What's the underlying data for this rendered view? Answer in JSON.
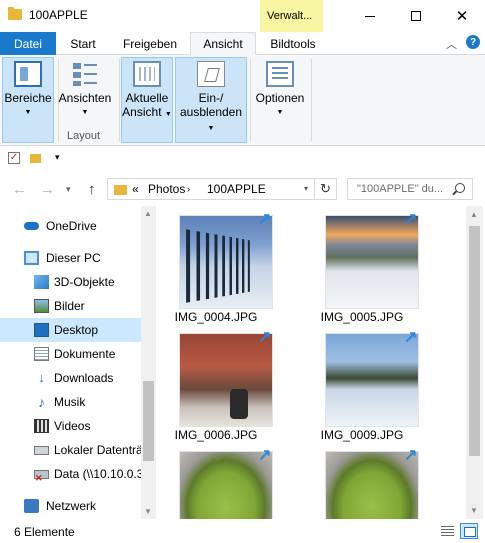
{
  "window": {
    "title": "100APPLE",
    "context_tab_header": "Verwalt...",
    "minimize_icon": "minimize-icon",
    "maximize_icon": "maximize-icon",
    "close_icon": "close-icon"
  },
  "tabs": [
    {
      "label": "Datei"
    },
    {
      "label": "Start"
    },
    {
      "label": "Freigeben"
    },
    {
      "label": "Ansicht"
    },
    {
      "label": "Bildtools"
    }
  ],
  "ribbon": {
    "groups": {
      "panes": {
        "button": "Bereiche"
      },
      "layout": {
        "button": "Ansichten",
        "label": "Layout"
      },
      "current_view": {
        "button_line1": "Aktuelle",
        "button_line2": "Ansicht"
      },
      "show_hide": {
        "button_line1": "Ein-/",
        "button_line2": "ausblenden"
      },
      "options": {
        "button": "Optionen"
      }
    }
  },
  "address": {
    "crumb_overflow": "«",
    "crumbs": [
      "Photos",
      "100APPLE"
    ],
    "search_placeholder": "\"100APPLE\" du..."
  },
  "nav_pane": {
    "items": [
      {
        "label": "OneDrive",
        "icon": "onedrive-icon"
      },
      {
        "label": "Dieser PC",
        "icon": "pc-icon"
      },
      {
        "label": "3D-Objekte",
        "icon": "3d-objects-icon"
      },
      {
        "label": "Bilder",
        "icon": "pictures-icon"
      },
      {
        "label": "Desktop",
        "icon": "desktop-icon",
        "selected": true
      },
      {
        "label": "Dokumente",
        "icon": "documents-icon"
      },
      {
        "label": "Downloads",
        "icon": "downloads-icon"
      },
      {
        "label": "Musik",
        "icon": "music-icon"
      },
      {
        "label": "Videos",
        "icon": "videos-icon"
      },
      {
        "label": "Lokaler Datenträ",
        "icon": "local-drive-icon"
      },
      {
        "label": "Data (\\\\10.10.0.3",
        "icon": "network-drive-icon"
      },
      {
        "label": "Netzwerk",
        "icon": "network-icon"
      }
    ]
  },
  "files": [
    {
      "name": "IMG_0004.JPG"
    },
    {
      "name": "IMG_0005.JPG"
    },
    {
      "name": "IMG_0006.JPG"
    },
    {
      "name": "IMG_0009.JPG"
    },
    {
      "name": ""
    },
    {
      "name": ""
    }
  ],
  "status": {
    "item_count": "6 Elemente"
  },
  "colors": {
    "accent": "#1979ca",
    "selection": "#cce8ff",
    "context_tab": "#f8f5a3"
  }
}
